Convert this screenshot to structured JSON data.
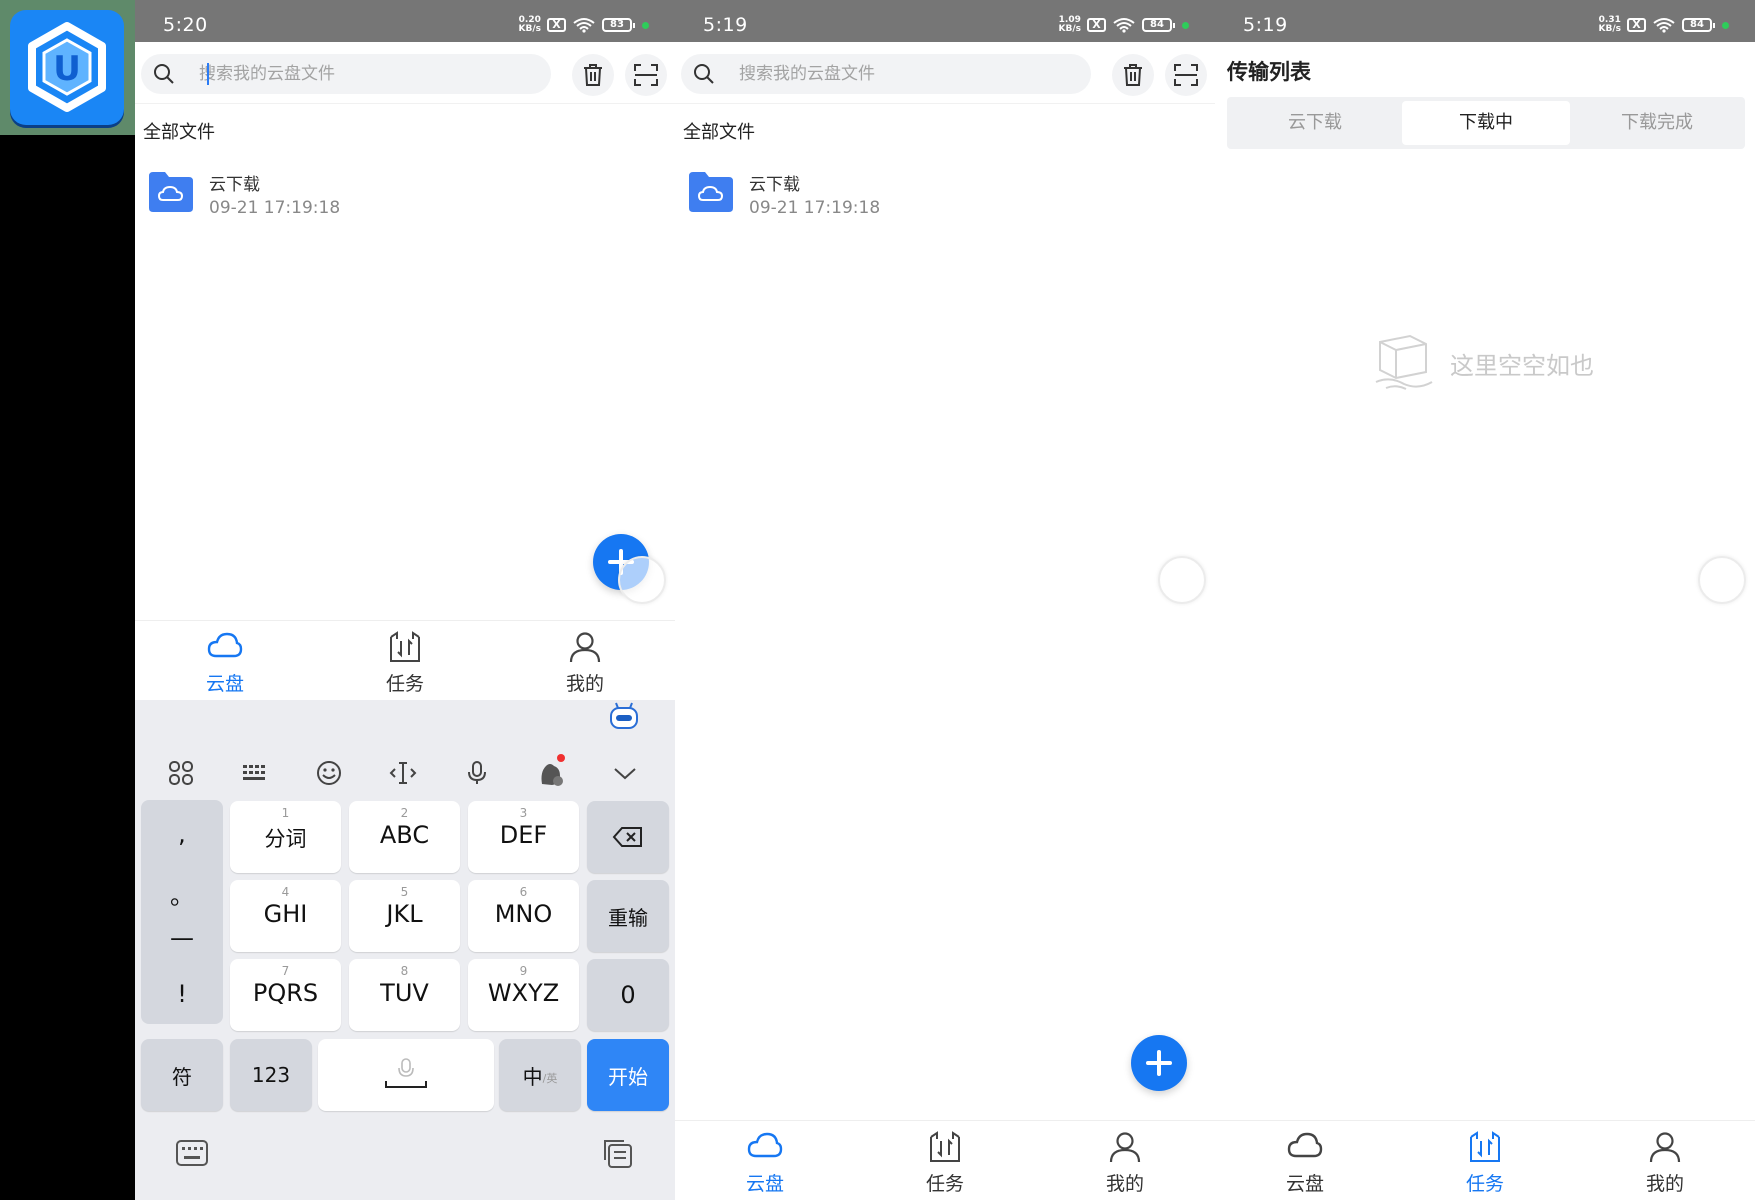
{
  "colors": {
    "accent": "#1677f2",
    "status_bar": "#767676",
    "app_icon_blue": "#1a86f5",
    "keyboard_bg": "#ecedf1",
    "keyboard_action": "#2f86f6"
  },
  "app_icon": {
    "glyph": "U"
  },
  "panel1": {
    "status": {
      "time": "5:20",
      "speed": "0.20",
      "speed_unit": "KB/s",
      "sim": "X",
      "battery": "83"
    },
    "search": {
      "placeholder": "搜索我的云盘文件"
    },
    "section_title": "全部文件",
    "files": [
      {
        "name": "云下载",
        "date": "09-21 17:19:18"
      }
    ],
    "tabs": [
      {
        "label": "云盘",
        "icon": "cloud-icon"
      },
      {
        "label": "任务",
        "icon": "task-icon"
      },
      {
        "label": "我的",
        "icon": "user-icon"
      }
    ],
    "active_tab": "云盘",
    "keyboard": {
      "toolbar_icons": [
        "grid-menu-icon",
        "keyboard-layout-icon",
        "emoji-icon",
        "cursor-icon",
        "microphone-icon",
        "theme-icon",
        "collapse-icon"
      ],
      "punctuation": [
        ",",
        "。",
        "—",
        "!"
      ],
      "keys": [
        {
          "num": "1",
          "label": "分词"
        },
        {
          "num": "2",
          "label": "ABC"
        },
        {
          "num": "3",
          "label": "DEF"
        },
        {
          "num": "4",
          "label": "GHI"
        },
        {
          "num": "5",
          "label": "JKL"
        },
        {
          "num": "6",
          "label": "MNO"
        },
        {
          "num": "7",
          "label": "PQRS"
        },
        {
          "num": "8",
          "label": "TUV"
        },
        {
          "num": "9",
          "label": "WXYZ"
        }
      ],
      "reinput_label": "重输",
      "zero_label": "0",
      "symbol_label": "符",
      "numbers_label": "123",
      "lang_label": "中",
      "lang_sub": "/英",
      "start_label": "开始"
    }
  },
  "panel2": {
    "status": {
      "time": "5:19",
      "speed": "1.09",
      "speed_unit": "KB/s",
      "sim": "X",
      "battery": "84"
    },
    "search": {
      "placeholder": "搜索我的云盘文件"
    },
    "section_title": "全部文件",
    "files": [
      {
        "name": "云下载",
        "date": "09-21 17:19:18"
      }
    ],
    "tabs": [
      {
        "label": "云盘",
        "icon": "cloud-icon"
      },
      {
        "label": "任务",
        "icon": "task-icon"
      },
      {
        "label": "我的",
        "icon": "user-icon"
      }
    ],
    "active_tab": "云盘"
  },
  "panel3": {
    "status": {
      "time": "5:19",
      "speed": "0.31",
      "speed_unit": "KB/s",
      "sim": "X",
      "battery": "84"
    },
    "title": "传输列表",
    "segments": [
      "云下载",
      "下载中",
      "下载完成"
    ],
    "active_segment": "下载中",
    "empty_text": "这里空空如也",
    "tabs": [
      {
        "label": "云盘",
        "icon": "cloud-icon"
      },
      {
        "label": "任务",
        "icon": "task-icon"
      },
      {
        "label": "我的",
        "icon": "user-icon"
      }
    ],
    "active_tab": "任务"
  }
}
